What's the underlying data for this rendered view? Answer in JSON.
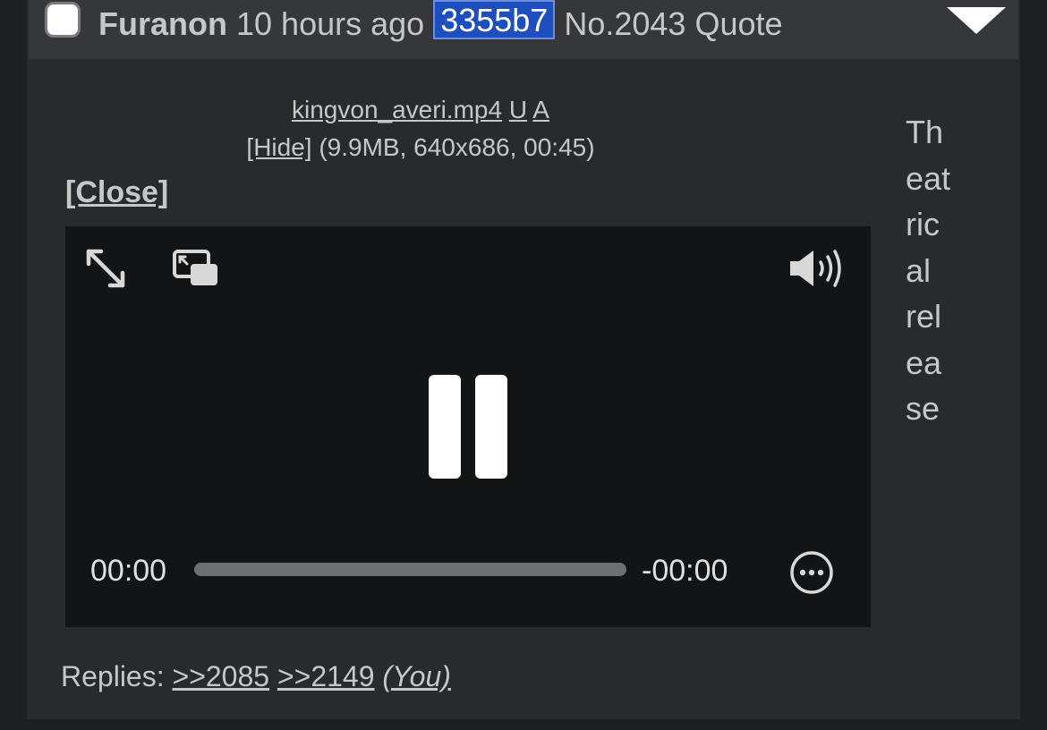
{
  "post": {
    "name": "Furanon",
    "time": "10 hours ago",
    "poster_id": "3355b7",
    "number": "No.2043",
    "quote_label": "Quote"
  },
  "file": {
    "filename": "kingvon_averi.mp4",
    "upload_label": "U",
    "a_label": "A",
    "hide_label": "[Hide]",
    "meta": "(9.9MB, 640x686, 00:45)",
    "close_label": "[Close]"
  },
  "video": {
    "current_time": "00:00",
    "remaining_time": "-00:00",
    "progress": 0
  },
  "comment_lines": [
    "Th",
    "eat",
    "ric",
    "al",
    "rel",
    "ea",
    "se"
  ],
  "replies": {
    "label": "Replies:",
    "links": [
      ">>2085",
      ">>2149"
    ],
    "you_label": "(You)"
  },
  "icons": {
    "expand": "fullscreen-expand-icon",
    "pip": "picture-in-picture-icon",
    "volume": "volume-icon",
    "pause": "pause-icon",
    "more": "more-options-icon",
    "menu": "post-menu-arrow-icon"
  },
  "colors": {
    "id_highlight": "#1f4fbf",
    "post_background": "#282a2e",
    "page_background": "#1d1f21"
  }
}
